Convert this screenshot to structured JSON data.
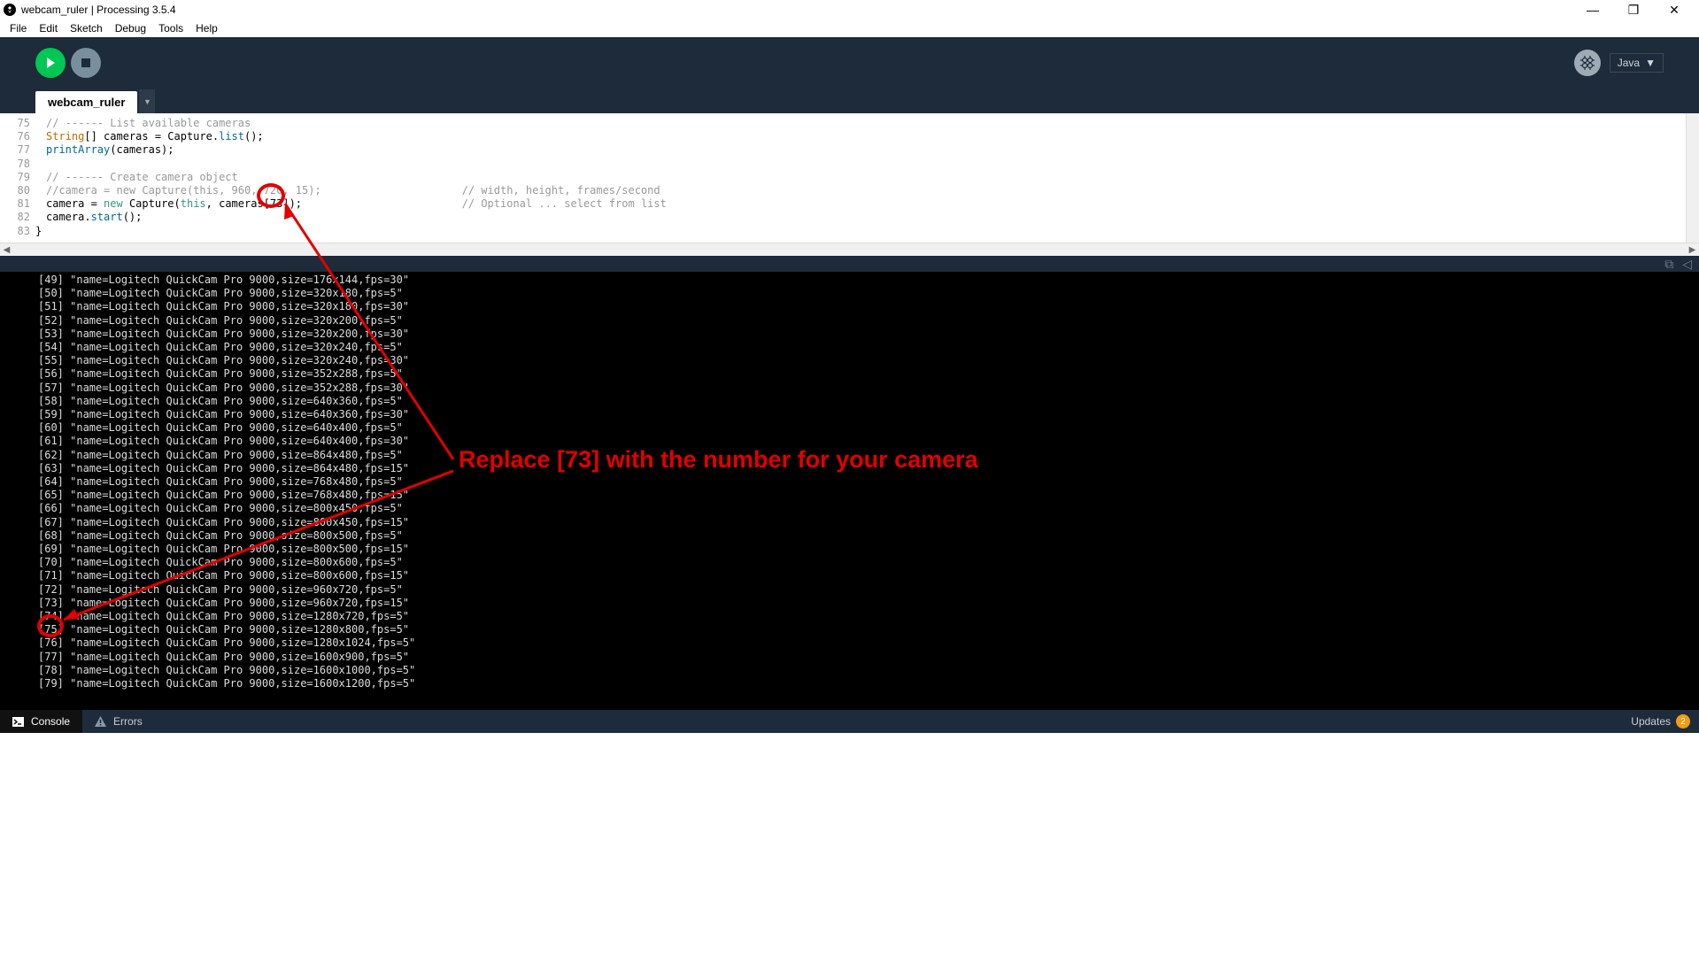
{
  "window": {
    "title": "webcam_ruler | Processing 3.5.4"
  },
  "menu": {
    "file": "File",
    "edit": "Edit",
    "sketch": "Sketch",
    "debug": "Debug",
    "tools": "Tools",
    "help": "Help"
  },
  "mode": {
    "label": "Java",
    "caret": "▼"
  },
  "tabs": {
    "active": "webcam_ruler"
  },
  "gutter": [
    "75",
    "76",
    "77",
    "78",
    "79",
    "80",
    "81",
    "82",
    "83"
  ],
  "code": {
    "l75": {
      "c": "// ------ List available cameras"
    },
    "l76": {
      "a": "String",
      "b": "[] cameras = Capture.",
      "c": "list",
      "d": "();"
    },
    "l77": {
      "a": "printArray",
      "b": "(cameras);"
    },
    "l78": "",
    "l79": {
      "c": "// ------ Create camera object"
    },
    "l80": {
      "c": "//camera = new Capture(this, 960, 720, 15);",
      "cc": "// width, height, frames/second"
    },
    "l81": {
      "a": "camera = ",
      "b": "new",
      "c": " Capture(",
      "d": "this",
      "e": ", cameras[",
      "f": "73",
      "g": "]);",
      "cc": "// Optional ... select from list"
    },
    "l82": {
      "a": "camera.",
      "b": "start",
      "c": "();"
    },
    "l83": "}"
  },
  "console_lines": [
    "[49] \"name=Logitech QuickCam Pro 9000,size=176x144,fps=30\"",
    "[50] \"name=Logitech QuickCam Pro 9000,size=320x180,fps=5\"",
    "[51] \"name=Logitech QuickCam Pro 9000,size=320x180,fps=30\"",
    "[52] \"name=Logitech QuickCam Pro 9000,size=320x200,fps=5\"",
    "[53] \"name=Logitech QuickCam Pro 9000,size=320x200,fps=30\"",
    "[54] \"name=Logitech QuickCam Pro 9000,size=320x240,fps=5\"",
    "[55] \"name=Logitech QuickCam Pro 9000,size=320x240,fps=30\"",
    "[56] \"name=Logitech QuickCam Pro 9000,size=352x288,fps=5\"",
    "[57] \"name=Logitech QuickCam Pro 9000,size=352x288,fps=30\"",
    "[58] \"name=Logitech QuickCam Pro 9000,size=640x360,fps=5\"",
    "[59] \"name=Logitech QuickCam Pro 9000,size=640x360,fps=30\"",
    "[60] \"name=Logitech QuickCam Pro 9000,size=640x400,fps=5\"",
    "[61] \"name=Logitech QuickCam Pro 9000,size=640x400,fps=30\"",
    "[62] \"name=Logitech QuickCam Pro 9000,size=864x480,fps=5\"",
    "[63] \"name=Logitech QuickCam Pro 9000,size=864x480,fps=15\"",
    "[64] \"name=Logitech QuickCam Pro 9000,size=768x480,fps=5\"",
    "[65] \"name=Logitech QuickCam Pro 9000,size=768x480,fps=15\"",
    "[66] \"name=Logitech QuickCam Pro 9000,size=800x450,fps=5\"",
    "[67] \"name=Logitech QuickCam Pro 9000,size=800x450,fps=15\"",
    "[68] \"name=Logitech QuickCam Pro 9000,size=800x500,fps=5\"",
    "[69] \"name=Logitech QuickCam Pro 9000,size=800x500,fps=15\"",
    "[70] \"name=Logitech QuickCam Pro 9000,size=800x600,fps=5\"",
    "[71] \"name=Logitech QuickCam Pro 9000,size=800x600,fps=15\"",
    "[72] \"name=Logitech QuickCam Pro 9000,size=960x720,fps=5\"",
    "[73] \"name=Logitech QuickCam Pro 9000,size=960x720,fps=15\"",
    "[74] \"name=Logitech QuickCam Pro 9000,size=1280x720,fps=5\"",
    "[75] \"name=Logitech QuickCam Pro 9000,size=1280x800,fps=5\"",
    "[76] \"name=Logitech QuickCam Pro 9000,size=1280x1024,fps=5\"",
    "[77] \"name=Logitech QuickCam Pro 9000,size=1600x900,fps=5\"",
    "[78] \"name=Logitech QuickCam Pro 9000,size=1600x1000,fps=5\"",
    "[79] \"name=Logitech QuickCam Pro 9000,size=1600x1200,fps=5\""
  ],
  "status": {
    "console": "Console",
    "errors": "Errors",
    "updates": "Updates",
    "count": "2"
  },
  "annotation": {
    "text": "Replace [73] with the number for your camera"
  }
}
